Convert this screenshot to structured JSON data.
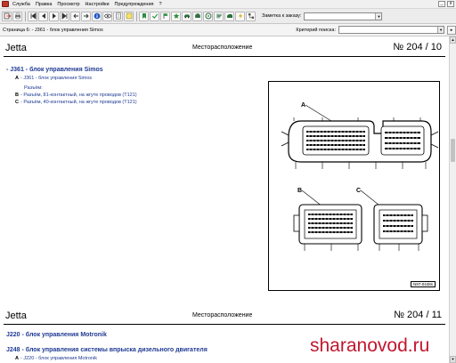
{
  "menu": {
    "items": [
      "Служба",
      "Правка",
      "Просмотр",
      "Настройки",
      "Предупреждения",
      "?"
    ]
  },
  "toolbar": {
    "note_label": "Заметка к заказу:"
  },
  "nav": {
    "breadcrumb": "Страница 6:  - J361 - блок управления Simos",
    "search_label": "Критерий поиска:"
  },
  "pages": [
    {
      "model": "Jetta",
      "section": "Месторасположение",
      "number": "№  204 / 10",
      "heading": "- J361 - блок управления Simos",
      "lines": [
        {
          "letter": "A",
          "text": "- J361 - блок управления Simos"
        },
        {
          "letter": "",
          "text": "Разъём:"
        },
        {
          "letter": "B",
          "text": "- Разъём, 81-контактный, на жгуте проводов (T121)"
        },
        {
          "letter": "C",
          "text": "- Разъём, 40-контактный, на жгуте проводов (T121)"
        }
      ],
      "figure": {
        "labels": [
          "A",
          "B",
          "C"
        ],
        "id": "N97-0448s"
      }
    },
    {
      "model": "Jetta",
      "section": "Месторасположение",
      "number": "№  204 / 11",
      "heading": "J220 - блок управления Motronik",
      "heading2": "J248 - блок управления системы впрыска дизельного двигателя",
      "lines": [
        {
          "letter": "A",
          "text": "- J220 - блок управления Motronik"
        }
      ]
    }
  ],
  "watermark": "sharanovod.ru",
  "icons": {
    "toolbar": [
      "exit-icon",
      "print-icon",
      "first-page-icon",
      "prev-page-icon",
      "next-page-icon",
      "last-page-icon",
      "back-icon",
      "forward-icon",
      "info-icon",
      "eye-icon",
      "document-icon",
      "notes-icon",
      "bookmark-icon",
      "check-icon",
      "flag-icon",
      "star-icon",
      "car-icon",
      "engine-icon",
      "wheel-icon",
      "gearbox-icon",
      "body-icon",
      "electrics-icon",
      "diagram-icon"
    ]
  },
  "colors": {
    "heading_blue": "#1f3a93",
    "watermark_red": "#c2162e",
    "app_icon_red": "#c0392b"
  }
}
